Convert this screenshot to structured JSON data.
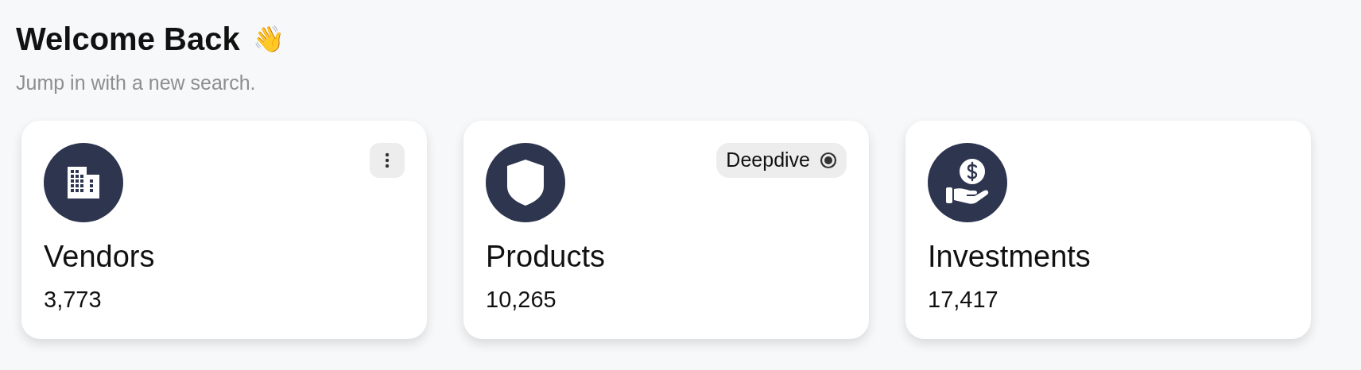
{
  "header": {
    "title": "Welcome Back",
    "emoji": "👋",
    "subtitle": "Jump in with a new search."
  },
  "cards": [
    {
      "title": "Vendors",
      "count": "3,773",
      "action": {
        "kind": "menu"
      }
    },
    {
      "title": "Products",
      "count": "10,265",
      "action": {
        "kind": "badge",
        "label": "Deepdive"
      }
    },
    {
      "title": "Investments",
      "count": "17,417"
    }
  ]
}
